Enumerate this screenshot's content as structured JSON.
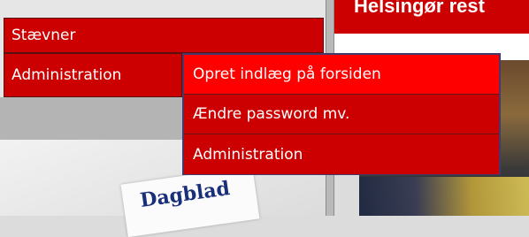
{
  "header": {
    "title": "Helsingør rest"
  },
  "menu": {
    "items": [
      {
        "label": "Stævner"
      },
      {
        "label": "Administration"
      }
    ],
    "submenu": [
      {
        "label": "Opret indlæg på forsiden"
      },
      {
        "label": "Ændre password mv."
      },
      {
        "label": "Administration"
      }
    ]
  },
  "newspaper": {
    "logo_text": "Dagblad"
  },
  "colors": {
    "menu_red": "#cc0000",
    "menu_highlight": "#ff0000",
    "menu_border": "#43396b"
  }
}
